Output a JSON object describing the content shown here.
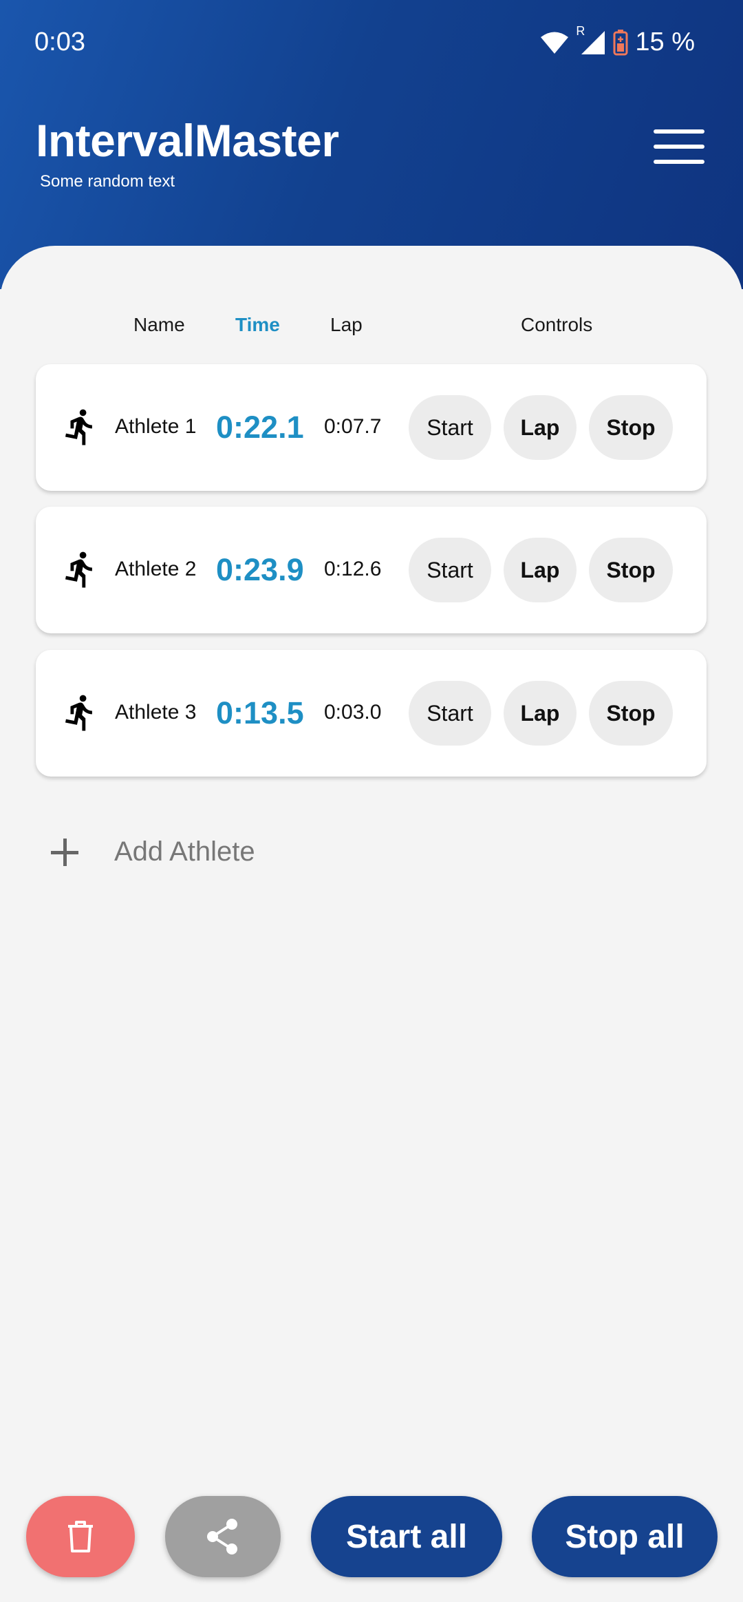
{
  "status_bar": {
    "time": "0:03",
    "roaming": "R",
    "battery": "15 %"
  },
  "header": {
    "title": "IntervalMaster",
    "subtitle": "Some random text"
  },
  "columns": {
    "name": "Name",
    "time": "Time",
    "lap": "Lap",
    "controls": "Controls"
  },
  "athletes": [
    {
      "name": "Athlete 1",
      "time": "0:22.1",
      "lap": "0:07.7",
      "start": "Start",
      "lap_btn": "Lap",
      "stop": "Stop"
    },
    {
      "name": "Athlete 2",
      "time": "0:23.9",
      "lap": "0:12.6",
      "start": "Start",
      "lap_btn": "Lap",
      "stop": "Stop"
    },
    {
      "name": "Athlete 3",
      "time": "0:13.5",
      "lap": "0:03.0",
      "start": "Start",
      "lap_btn": "Lap",
      "stop": "Stop"
    }
  ],
  "add_athlete": "Add Athlete",
  "bottom": {
    "start_all": "Start all",
    "stop_all": "Stop all"
  },
  "icons": [
    "wifi-icon",
    "signal-icon",
    "battery-icon",
    "menu-icon",
    "runner-icon",
    "add-icon",
    "trash-icon",
    "share-icon"
  ],
  "colors": {
    "header": "#12418f",
    "accent": "#1e8fc4",
    "delete": "#f17171",
    "share": "#a0a0a0",
    "primary": "#16438f"
  }
}
